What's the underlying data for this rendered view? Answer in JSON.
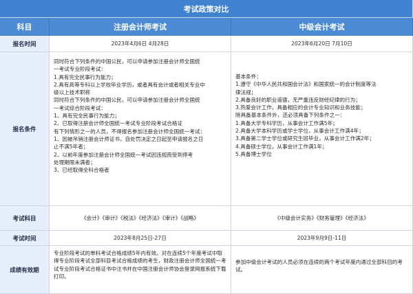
{
  "title": "考试政策对比",
  "header": {
    "col_label": "科目",
    "col_a": "注册会计师考试",
    "col_b": "中级会计考试"
  },
  "rows": {
    "register_time": {
      "label": "报名时间",
      "a": "2023年4月6日 4月28日",
      "b": "2023年6月20日 7月10日"
    },
    "conditions": {
      "label": "报名条件",
      "a": [
        "同时符合下列条件的中国公民，可以申请参加注册会计师全国统",
        "一考试专业阶段考试：",
        "1.具有完全民事行为能力；",
        "2.具有高等专科以上学校毕业学历，或者具有会计或者相关专业中",
        "级以上技术职称",
        "同时符合下列条件的中国公民，可以申请参加注册会计师全国统",
        "一考试综合阶段考试：",
        "1、具有完全民事行为能力；",
        "2、已取得注册会计师全国统一考试专业阶段考试合格证",
        "有下列情形之一的人员，不得报名参加注册会计师全国统一考试：",
        "1、因被吊销注册会计师证书，自处罚决定之日起至申请报名之日",
        "止不满5年者；",
        "2、以前年度参加注册会计师全国统一考试因违规而受到停考",
        "处理期限未满者；",
        "3、已经取得全科合格者"
      ],
      "b": [
        "基本条件：",
        "1.遵守《中华人民共和国会计法》和国家统一的会计制度等法",
        "律法规；",
        "2.具备良好的职业道德，无严重违反财经纪律的行为；",
        "3.热爱会计工作，具备相应的会计专业知识和业务技能；",
        "除具备基本条件外，还必须具备下列条件之一：",
        "1.具备大学专科学历，从事会计工作满5年；",
        "2.具备大学本科学历或学士学位，从事会计工作满4年；",
        "3.具备第二学士学位或研究生班毕业，从事会计工作满2年；",
        "4.具备硕士学位，从事会计工作满1年；",
        "5.具备博士学位"
      ]
    },
    "subjects": {
      "label": "考试科目",
      "a": "《会计》《审计》《税法》《经济法》《审计》《战略》",
      "b": "《中级会计实务》《财务管理》《经济法》"
    },
    "exam_time": {
      "label": "考试时间",
      "a": "2023年8月25日-27日",
      "b": "2023年9月9日-11日"
    },
    "validity": {
      "label": "成绩有效期",
      "a": "专业阶段考试的单科考试合格成绩5年内有效。对在连续5个年度考试中取得专业阶段考试全部科目考试合格成绩的考生，财政注册会计师全国统一考试专业阶段考试合格证书中注书并在中国注册会计师协会登录网报系统下载打印。",
      "b": "参加中级会计考试的人员必须在连续的两个考试年度内通过全部科目的考试。"
    }
  },
  "colors": {
    "header_bg": "#4a8bd3",
    "label_bg": "#e6eefb",
    "grid": "#cfd6e2"
  }
}
